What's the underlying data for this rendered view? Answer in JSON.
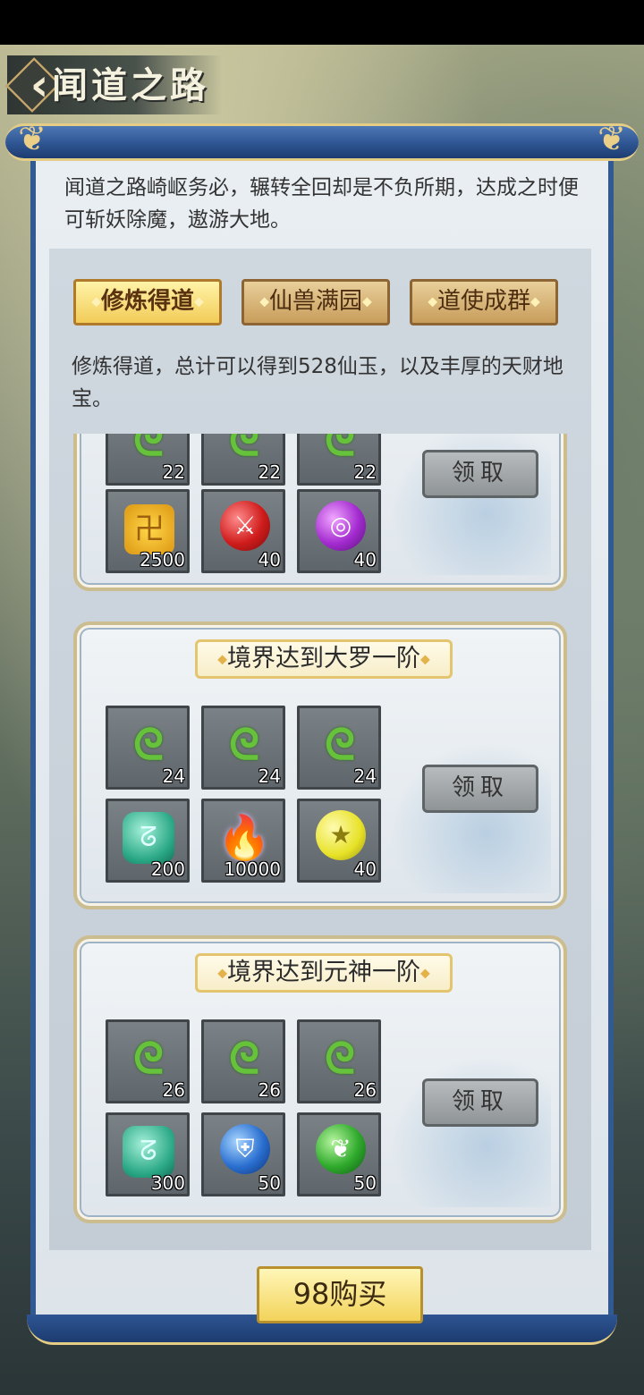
{
  "header": {
    "title": "闻道之路"
  },
  "intro": "闻道之路崎岖务必，辗转全回却是不负所期，达成之时便可斩妖除魔，遨游大地。",
  "tabs": [
    {
      "label": "修炼得道",
      "active": true
    },
    {
      "label": "仙兽满园",
      "active": false
    },
    {
      "label": "道使成群",
      "active": false
    }
  ],
  "tab_description": "修炼得道，总计可以得到528仙玉，以及丰厚的天财地宝。",
  "cards": [
    {
      "title": "",
      "items": [
        {
          "icon": "dragon-jade-icon",
          "glyph": "ᘓ",
          "count": "22"
        },
        {
          "icon": "dragon-jade-icon",
          "glyph": "ᘓ",
          "count": "22"
        },
        {
          "icon": "dragon-jade-icon",
          "glyph": "ᘓ",
          "count": "22"
        },
        {
          "icon": "gold-token-icon",
          "glyph": "卍",
          "count": "2500"
        },
        {
          "icon": "red-sword-orb-icon",
          "glyph": "⚔",
          "count": "40"
        },
        {
          "icon": "purple-orb-icon",
          "glyph": "◎",
          "count": "40"
        }
      ],
      "claim_label": "领取"
    },
    {
      "title": "境界达到大罗一阶",
      "items": [
        {
          "icon": "dragon-jade-icon",
          "glyph": "ᘓ",
          "count": "24"
        },
        {
          "icon": "dragon-jade-icon",
          "glyph": "ᘓ",
          "count": "24"
        },
        {
          "icon": "dragon-jade-icon",
          "glyph": "ᘓ",
          "count": "24"
        },
        {
          "icon": "jade-stone-icon",
          "glyph": "ᘔ",
          "count": "200"
        },
        {
          "icon": "purple-flame-icon",
          "glyph": "🔥",
          "count": "10000"
        },
        {
          "icon": "yellow-star-orb-icon",
          "glyph": "★",
          "count": "40"
        }
      ],
      "claim_label": "领取"
    },
    {
      "title": "境界达到元神一阶",
      "items": [
        {
          "icon": "dragon-jade-icon",
          "glyph": "ᘓ",
          "count": "26"
        },
        {
          "icon": "dragon-jade-icon",
          "glyph": "ᘓ",
          "count": "26"
        },
        {
          "icon": "dragon-jade-icon",
          "glyph": "ᘓ",
          "count": "26"
        },
        {
          "icon": "jade-stone-icon",
          "glyph": "ᘔ",
          "count": "300"
        },
        {
          "icon": "blue-shield-orb-icon",
          "glyph": "⛨",
          "count": "50"
        },
        {
          "icon": "green-leaf-orb-icon",
          "glyph": "❦",
          "count": "50"
        }
      ],
      "claim_label": "领取"
    }
  ],
  "buy_button": {
    "label": "98购买"
  }
}
